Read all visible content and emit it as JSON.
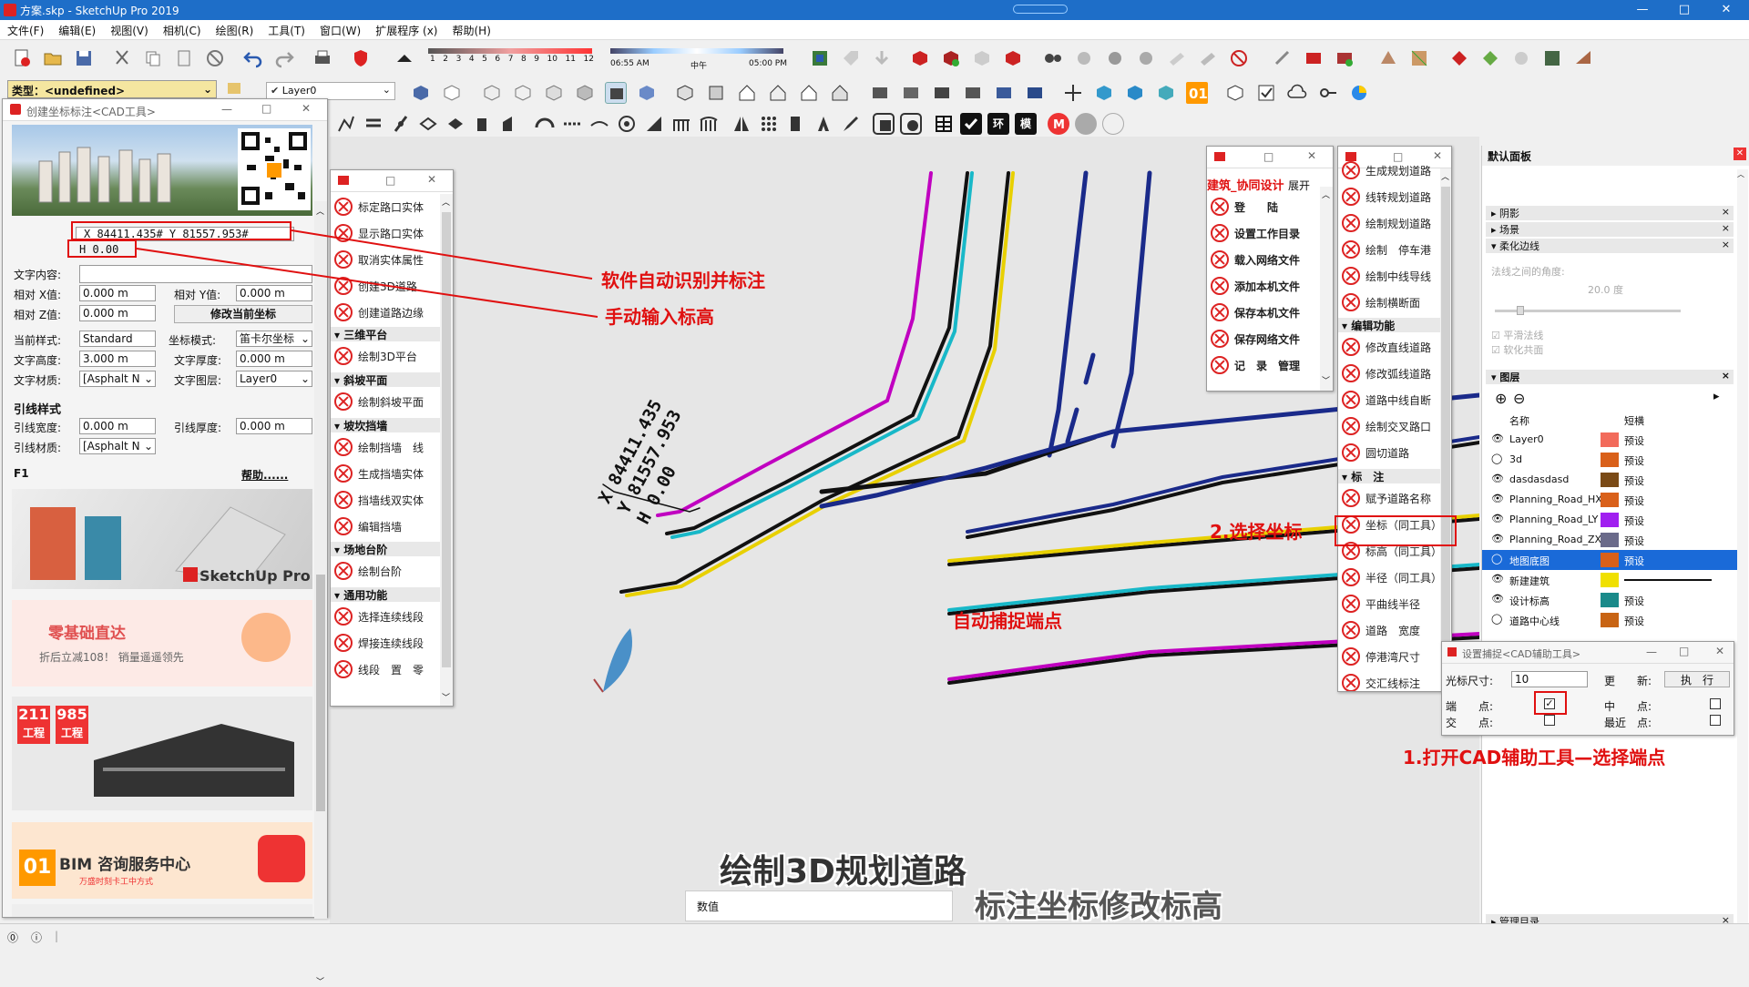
{
  "window": {
    "title": "方案.skp - SketchUp Pro 2019",
    "minimize": "—",
    "maximize": "□",
    "close": "✕"
  },
  "menu": [
    "文件(F)",
    "编辑(E)",
    "视图(V)",
    "相机(C)",
    "绘图(R)",
    "工具(T)",
    "窗口(W)",
    "扩展程序 (x)",
    "帮助(H)"
  ],
  "timebar": {
    "ticks": [
      "1",
      "2",
      "3",
      "4",
      "5",
      "6",
      "7",
      "8",
      "9",
      "10",
      "11",
      "12"
    ],
    "time_start": "06:55 AM",
    "time_mid": "中午",
    "time_end": "05:00 PM"
  },
  "type_selector": {
    "label": "类型：<undefined>"
  },
  "layer_selector": {
    "value": "Layer0"
  },
  "cad_dialog": {
    "title": "创建坐标标注<CAD工具>",
    "coord_text": "X 84411.435# Y 81557.953#",
    "h_text": "H 0.00",
    "text_content_label": "文字内容:",
    "rel_x_label": "相对 X值:",
    "rel_x": "0.000 m",
    "rel_y_label": "相对 Y值:",
    "rel_y": "0.000 m",
    "rel_z_label": "相对 Z值:",
    "rel_z": "0.000 m",
    "modify_btn": "修改当前坐标",
    "style_label": "当前样式:",
    "style": "Standard",
    "coord_mode_label": "坐标模式:",
    "coord_mode": "笛卡尔坐标",
    "text_height_label": "文字高度:",
    "text_height": "3.000 m",
    "text_thickness_label": "文字厚度:",
    "text_thickness": "0.000 m",
    "text_material_label": "文字材质:",
    "text_material": "[Asphalt N",
    "text_layer_label": "文字图层:",
    "text_layer": "Layer0",
    "leader_style": "引线样式",
    "leader_width_label": "引线宽度:",
    "leader_width": "0.000 m",
    "leader_thickness_label": "引线厚度:",
    "leader_thickness": "0.000 m",
    "leader_material_label": "引线材质:",
    "leader_material": "[Asphalt N",
    "f1": "F1",
    "help": "帮助......",
    "ad_sketchup": "SketchUp Pro",
    "ad_zero": "零基础直达",
    "ad_zero_sub": "折后立减108！ 销量遥遥领先",
    "ad_211": "211",
    "ad_985": "985",
    "ad_gc": "工程",
    "ad_bim": "BIM 咨询服务中心",
    "ad_bim_sub": "万盛时刻卡工中方式"
  },
  "tool_panel1": {
    "items_a": [
      "标定路口实体",
      "显示路口实体",
      "取消实体属性",
      "创建3D道路",
      "创建道路边缘"
    ],
    "sec1": "三维平台",
    "items_b": [
      "绘制3D平台"
    ],
    "sec2": "斜坡平面",
    "items_c": [
      "绘制斜坡平面"
    ],
    "sec3": "坡坎挡墙",
    "items_d": [
      "绘制挡墙　线",
      "生成挡墙实体",
      "挡墙线双实体",
      "编辑挡墙"
    ],
    "sec4": "场地台阶",
    "items_e": [
      "绘制台阶"
    ],
    "sec5": "通用功能",
    "items_f": [
      "选择连续线段",
      "焊接连续线段",
      "线段　置　零"
    ]
  },
  "collab_panel": {
    "header": "建筑_协同设计",
    "expand": "展开",
    "items": [
      "登　　陆",
      "设置工作目录",
      "载入网络文件",
      "添加本机文件",
      "保存本机文件",
      "保存网络文件",
      "记　录　管理"
    ]
  },
  "tool_panel2": {
    "items_a": [
      "生成规划道路",
      "线转规划道路",
      "绘制规划道路",
      "绘制　停车港",
      "绘制中线导线",
      "绘制横断面"
    ],
    "sec1": "编辑功能",
    "items_b": [
      "修改直线道路",
      "修改弧线道路",
      "道路中线自断",
      "绘制交叉路口",
      "圆切道路"
    ],
    "sec2": "标　注",
    "items_c": [
      "赋予道路名称",
      "坐标（同工具）",
      "标高（同工具）",
      "半径（同工具）",
      "平曲线半径",
      "道路　宽度",
      "停港湾尺寸",
      "交汇线标注"
    ]
  },
  "tray": {
    "title": "默认面板",
    "shadow": "阴影",
    "scene": "场景",
    "soften": "柔化边线",
    "angle_label": "法线之间的角度:",
    "angle_value": "20.0 度",
    "smooth_normals": "平滑法线",
    "soften_coplanar": "软化共面",
    "layers": "图层",
    "col_name": "名称",
    "col_line": "短横",
    "layer_rows": [
      {
        "name": "Layer0",
        "line": "预设",
        "color": "#f26b5b",
        "visible": true
      },
      {
        "name": "3d",
        "line": "预设",
        "color": "#d9601a",
        "visible": false
      },
      {
        "name": "dasdasdasd",
        "line": "预设",
        "color": "#7a4a16",
        "visible": true
      },
      {
        "name": "Planning_Road_HX",
        "line": "预设",
        "color": "#d9601a",
        "visible": true
      },
      {
        "name": "Planning_Road_LY",
        "line": "预设",
        "color": "#a020f0",
        "visible": true
      },
      {
        "name": "Planning_Road_ZX",
        "line": "预设",
        "color": "#6a6a8a",
        "visible": true
      },
      {
        "name": "地图底图",
        "line": "预设",
        "color": "#d9601a",
        "visible": false
      },
      {
        "name": "新建建筑",
        "line": "",
        "color": "#f0e000",
        "visible": true
      },
      {
        "name": "设计标高",
        "line": "预设",
        "color": "#1a8a8a",
        "visible": true
      },
      {
        "name": "道路中心线",
        "line": "预设",
        "color": "#c86414",
        "visible": false
      }
    ],
    "manage": "管理目录"
  },
  "snap_dialog": {
    "title": "设置捕捉<CAD辅助工具>",
    "cursor_label": "光标尺寸:",
    "cursor_value": "10",
    "update_label": "更　　新:",
    "execute": "执　行",
    "endpoint": "端　　点:",
    "midpoint": "中　　点:",
    "intersect": "交　　点:",
    "nearest": "最近　点:"
  },
  "canvas_label": {
    "x": "X 84411.435",
    "y": "Y 81557.953",
    "h": "H 0.00"
  },
  "annotations": {
    "auto_label": "软件自动识别并标注",
    "manual_h": "手动输入标高",
    "select_coord": "2.选择坐标",
    "auto_snap": "自动捕捉端点",
    "open_cad": "1.打开CAD辅助工具—选择端点"
  },
  "captions": {
    "line1": "绘制3D规划道路",
    "line2": "标注坐标修改标高"
  },
  "status": {
    "value_label": "数值"
  }
}
